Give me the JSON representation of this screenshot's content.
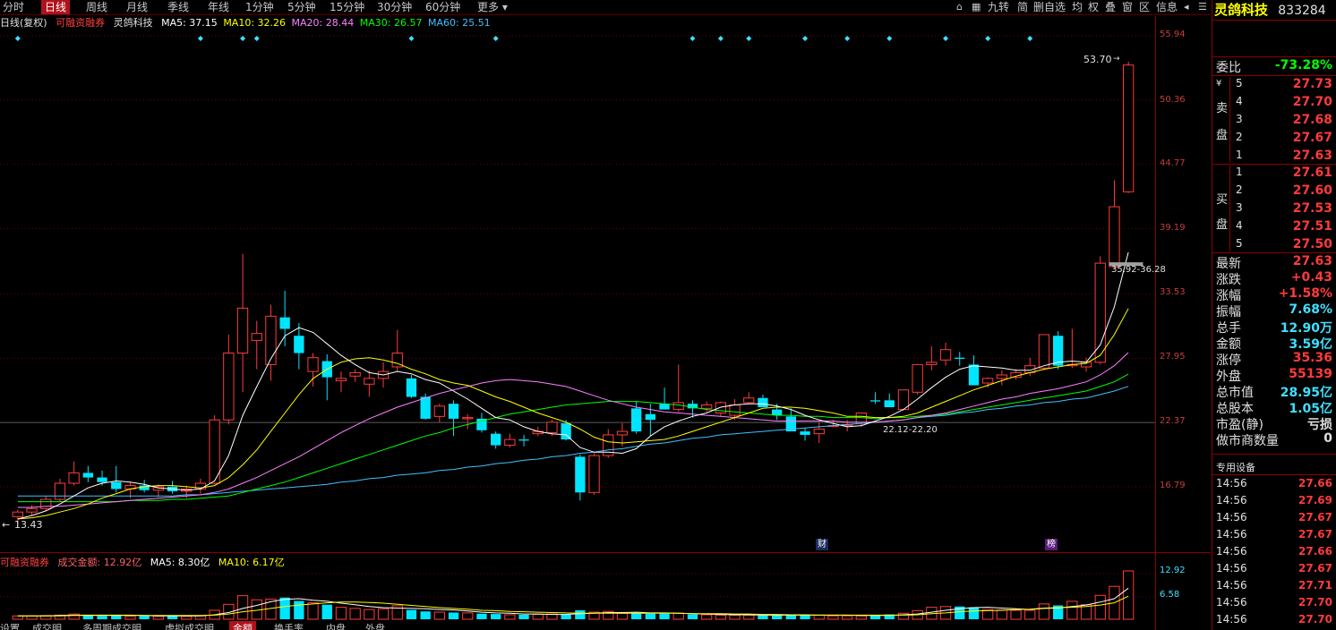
{
  "period_tabs": [
    "分时",
    "日线",
    "周线",
    "月线",
    "季线",
    "年线",
    "1分钟",
    "5分钟",
    "15分钟",
    "30分钟",
    "60分钟",
    "更多"
  ],
  "active_period": "日线",
  "toolbar": [
    "九转",
    "简",
    "删自选",
    "均",
    "权",
    "叠",
    "窗",
    "区",
    "信息"
  ],
  "stock": {
    "name": "灵鸽科技",
    "code": "833284"
  },
  "ma_line": {
    "period": "日线(复权)",
    "tag": "可融资融券",
    "name": "灵鸽科技",
    "ma5": "MA5: 37.15",
    "ma10": "MA10: 32.26",
    "ma20": "MA20: 28.44",
    "ma30": "MA30: 26.57",
    "ma60": "MA60: 25.51"
  },
  "price_axis": [
    "55.94",
    "50.36",
    "44.77",
    "39.19",
    "33.53",
    "27.95",
    "22.37",
    "16.79"
  ],
  "annotations": {
    "high": "53.70",
    "low": "13.43",
    "gap1": "35.92-36.28",
    "gap2": "22.12-22.20",
    "marker_cai": "财",
    "marker_bang": "榜"
  },
  "volume_line": {
    "tag": "可融资融券",
    "amount": "成交金额: 12.92亿",
    "ma5": "MA5: 8.30亿",
    "ma10": "MA10: 6.17亿"
  },
  "volume_axis": [
    "12.92",
    "6.58"
  ],
  "bottom_tabs": [
    "设置",
    "成交明",
    "多周期成交明",
    "虚拟成交明",
    "金额",
    "换手率",
    "内盘",
    "外盘"
  ],
  "order_book": {
    "weibi_label": "委比",
    "weibi_value": "-73.28%",
    "sell_label": [
      "卖",
      "盘"
    ],
    "buy_label": [
      "买",
      "盘"
    ],
    "sell": [
      [
        "5",
        "27.73"
      ],
      [
        "4",
        "27.70"
      ],
      [
        "3",
        "27.68"
      ],
      [
        "2",
        "27.67"
      ],
      [
        "1",
        "27.63"
      ]
    ],
    "buy": [
      [
        "1",
        "27.61"
      ],
      [
        "2",
        "27.60"
      ],
      [
        "3",
        "27.53"
      ],
      [
        "4",
        "27.51"
      ],
      [
        "5",
        "27.50"
      ]
    ]
  },
  "quote": [
    {
      "label": "最新",
      "value": "27.63",
      "color": "#ff3b3b"
    },
    {
      "label": "涨跌",
      "value": "+0.43",
      "color": "#ff3b3b"
    },
    {
      "label": "涨幅",
      "value": "+1.58%",
      "color": "#ff3b3b"
    },
    {
      "label": "振幅",
      "value": "7.68%",
      "color": "#40e0ff"
    },
    {
      "label": "总手",
      "value": "12.90万",
      "color": "#40e0ff"
    },
    {
      "label": "金额",
      "value": "3.59亿",
      "color": "#40e0ff"
    },
    {
      "label": "涨停",
      "value": "35.36",
      "color": "#ff3b3b"
    },
    {
      "label": "外盘",
      "value": "55139",
      "color": "#ff3b3b"
    },
    {
      "label": "总市值",
      "value": "28.95亿",
      "color": "#40e0ff"
    },
    {
      "label": "总股本",
      "value": "1.05亿",
      "color": "#40e0ff"
    },
    {
      "label": "市盈(静)",
      "value": "亏损",
      "color": "#e0e0e0"
    },
    {
      "label": "做市商数量",
      "value": "0",
      "color": "#e0e0e0"
    }
  ],
  "device_label": "专用设备",
  "ticks": [
    [
      "14:56",
      "27.66"
    ],
    [
      "14:56",
      "27.69"
    ],
    [
      "14:56",
      "27.67"
    ],
    [
      "14:56",
      "27.67"
    ],
    [
      "14:56",
      "27.66"
    ],
    [
      "14:56",
      "27.67"
    ],
    [
      "14:56",
      "27.71"
    ],
    [
      "14:56",
      "27.70"
    ],
    [
      "14:56",
      "27.70"
    ]
  ],
  "colors": {
    "up": "#ff3b3b",
    "down": "#00e5ff",
    "ma5": "#ffffff",
    "ma10": "#ffff00",
    "ma20": "#ff80ff",
    "ma30": "#00ff00",
    "ma60": "#40c0ff"
  },
  "kline": [
    [
      14.2,
      14.8,
      13.4,
      14.6
    ],
    [
      14.6,
      15.2,
      14.3,
      14.9
    ],
    [
      14.9,
      16.0,
      14.7,
      15.7
    ],
    [
      15.7,
      17.5,
      15.5,
      17.1
    ],
    [
      17.1,
      19.0,
      16.9,
      18.0
    ],
    [
      18.0,
      18.6,
      17.2,
      17.6
    ],
    [
      17.6,
      18.2,
      16.9,
      17.2
    ],
    [
      17.2,
      18.6,
      16.3,
      16.6
    ],
    [
      16.6,
      17.2,
      15.8,
      16.9
    ],
    [
      16.9,
      17.4,
      16.3,
      16.5
    ],
    [
      16.5,
      17.0,
      15.9,
      16.8
    ],
    [
      16.8,
      17.3,
      16.2,
      16.4
    ],
    [
      16.4,
      16.9,
      15.8,
      16.6
    ],
    [
      16.6,
      17.5,
      16.2,
      17.1
    ],
    [
      17.1,
      23.0,
      17.0,
      22.6
    ],
    [
      22.6,
      30.0,
      22.2,
      28.4
    ],
    [
      28.4,
      37.0,
      25.0,
      32.3
    ],
    [
      29.5,
      31.2,
      27.0,
      30.1
    ],
    [
      27.4,
      32.6,
      26.0,
      31.6
    ],
    [
      31.5,
      33.8,
      29.0,
      30.5
    ],
    [
      29.9,
      31.0,
      27.0,
      28.4
    ],
    [
      26.8,
      28.4,
      25.5,
      28.0
    ],
    [
      27.7,
      28.3,
      24.3,
      26.3
    ],
    [
      26.0,
      26.8,
      25.0,
      26.2
    ],
    [
      26.4,
      27.0,
      25.9,
      26.7
    ],
    [
      25.7,
      26.9,
      24.6,
      26.2
    ],
    [
      26.2,
      27.6,
      25.4,
      26.8
    ],
    [
      27.2,
      30.4,
      26.8,
      28.4
    ],
    [
      26.2,
      26.5,
      24.5,
      24.6
    ],
    [
      24.6,
      24.9,
      22.6,
      22.7
    ],
    [
      22.9,
      24.0,
      22.4,
      23.8
    ],
    [
      24.0,
      24.3,
      21.2,
      22.7
    ],
    [
      22.7,
      23.1,
      21.8,
      22.8
    ],
    [
      22.7,
      23.2,
      21.5,
      21.7
    ],
    [
      21.4,
      21.6,
      20.1,
      20.4
    ],
    [
      20.4,
      21.4,
      20.2,
      20.9
    ],
    [
      20.9,
      21.3,
      20.3,
      20.8
    ],
    [
      21.4,
      22.0,
      21.2,
      21.6
    ],
    [
      21.5,
      22.6,
      21.2,
      22.4
    ],
    [
      22.3,
      22.6,
      20.8,
      20.9
    ],
    [
      19.4,
      19.6,
      15.6,
      16.3
    ],
    [
      16.3,
      19.7,
      16.1,
      19.5
    ],
    [
      19.5,
      21.8,
      19.3,
      21.3
    ],
    [
      21.3,
      22.3,
      20.3,
      21.6
    ],
    [
      23.6,
      24.2,
      21.4,
      21.6
    ],
    [
      23.1,
      24.0,
      21.2,
      22.6
    ],
    [
      24.0,
      25.4,
      23.8,
      23.5
    ],
    [
      23.5,
      27.4,
      23.3,
      24.1
    ],
    [
      24.0,
      24.3,
      22.8,
      23.6
    ],
    [
      23.6,
      24.2,
      23.3,
      23.9
    ],
    [
      23.2,
      24.2,
      22.9,
      24.1
    ],
    [
      23.0,
      24.4,
      22.6,
      23.9
    ],
    [
      24.1,
      25.0,
      24.0,
      24.5
    ],
    [
      24.5,
      24.8,
      24.0,
      23.7
    ],
    [
      23.5,
      24.0,
      22.6,
      23.0
    ],
    [
      22.9,
      23.6,
      22.5,
      21.6
    ],
    [
      21.6,
      21.9,
      20.8,
      21.3
    ],
    [
      21.4,
      22.4,
      20.6,
      21.8
    ],
    [
      22.1,
      22.6,
      22.0,
      22.1
    ],
    [
      22.1,
      22.6,
      21.6,
      22.2
    ],
    [
      22.3,
      23.0,
      22.0,
      23.2
    ],
    [
      24.3,
      25.0,
      24.0,
      24.2
    ],
    [
      24.3,
      24.9,
      23.8,
      23.7
    ],
    [
      23.5,
      24.2,
      23.4,
      25.2
    ],
    [
      25.0,
      26.6,
      24.8,
      27.4
    ],
    [
      27.4,
      29.0,
      26.9,
      27.6
    ],
    [
      27.8,
      29.3,
      27.3,
      28.7
    ],
    [
      28.0,
      28.5,
      27.3,
      27.9
    ],
    [
      27.4,
      28.2,
      25.8,
      25.6
    ],
    [
      25.8,
      26.3,
      25.4,
      26.2
    ],
    [
      26.2,
      26.9,
      25.6,
      26.5
    ],
    [
      26.3,
      27.0,
      26.1,
      26.7
    ],
    [
      26.7,
      28.0,
      26.4,
      27.3
    ],
    [
      27.1,
      28.0,
      26.9,
      30.0
    ],
    [
      29.9,
      30.3,
      27.0,
      27.3
    ],
    [
      27.3,
      30.5,
      27.1,
      27.4
    ],
    [
      27.2,
      28.0,
      26.8,
      27.6
    ],
    [
      27.6,
      36.8,
      27.4,
      36.2
    ],
    [
      35.9,
      43.4,
      35.7,
      41.1
    ],
    [
      42.4,
      53.7,
      42.3,
      53.4
    ]
  ],
  "ma5": [
    14.0,
    14.3,
    14.7,
    15.3,
    16.0,
    16.7,
    17.1,
    17.3,
    17.2,
    17.0,
    16.7,
    16.6,
    16.5,
    16.6,
    17.3,
    19.5,
    23.0,
    25.5,
    27.9,
    29.9,
    30.6,
    30.2,
    29.2,
    28.2,
    27.4,
    26.7,
    26.5,
    26.8,
    26.6,
    26.1,
    25.8,
    25.1,
    24.4,
    23.6,
    22.8,
    22.6,
    22.0,
    21.6,
    21.4,
    21.3,
    20.2,
    19.8,
    19.8,
    19.7,
    20.1,
    21.2,
    22.0,
    22.5,
    22.9,
    23.2,
    23.7,
    23.9,
    24.0,
    24.0,
    23.8,
    23.5,
    23.0,
    22.6,
    22.3,
    22.0,
    22.1,
    22.5,
    22.9,
    23.5,
    24.4,
    25.4,
    26.3,
    27.0,
    27.3,
    27.2,
    27.1,
    26.9,
    26.9,
    27.3,
    27.6,
    27.7,
    27.6,
    29.1,
    32.4,
    37.15
  ],
  "ma10": [
    14.0,
    14.1,
    14.3,
    14.6,
    14.9,
    15.3,
    15.8,
    16.2,
    16.6,
    16.8,
    16.9,
    16.9,
    16.8,
    16.7,
    16.9,
    17.6,
    18.7,
    20.0,
    21.6,
    23.2,
    24.8,
    26.2,
    27.0,
    27.6,
    27.9,
    28.0,
    27.8,
    27.5,
    27.0,
    26.6,
    26.1,
    25.8,
    25.6,
    25.1,
    24.6,
    24.2,
    23.7,
    23.2,
    22.8,
    22.4,
    21.8,
    21.1,
    20.7,
    20.6,
    20.7,
    20.8,
    20.9,
    21.2,
    21.6,
    22.0,
    22.4,
    22.8,
    23.2,
    23.6,
    23.7,
    23.7,
    23.6,
    23.4,
    23.2,
    22.9,
    22.9,
    22.8,
    22.8,
    22.9,
    23.2,
    23.7,
    24.2,
    24.7,
    25.2,
    25.6,
    26.0,
    26.4,
    26.7,
    27.0,
    27.2,
    27.4,
    27.5,
    28.2,
    30.0,
    32.26
  ],
  "ma20": [
    15.0,
    15.0,
    15.1,
    15.1,
    15.2,
    15.3,
    15.4,
    15.5,
    15.6,
    15.7,
    15.8,
    15.9,
    16.0,
    16.1,
    16.3,
    16.6,
    17.1,
    17.6,
    18.2,
    18.8,
    19.4,
    20.1,
    20.8,
    21.5,
    22.1,
    22.7,
    23.2,
    23.7,
    24.1,
    24.5,
    24.9,
    25.2,
    25.5,
    25.8,
    26.0,
    26.1,
    26.0,
    25.9,
    25.7,
    25.5,
    25.1,
    24.7,
    24.3,
    24.0,
    23.7,
    23.5,
    23.3,
    23.2,
    23.1,
    23.0,
    22.9,
    22.8,
    22.7,
    22.6,
    22.5,
    22.5,
    22.5,
    22.5,
    22.5,
    22.4,
    22.4,
    22.4,
    22.5,
    22.6,
    22.8,
    23.0,
    23.2,
    23.5,
    23.8,
    24.1,
    24.4,
    24.6,
    24.9,
    25.1,
    25.3,
    25.6,
    25.9,
    26.5,
    27.3,
    28.44
  ],
  "ma30": [
    15.5,
    15.5,
    15.5,
    15.5,
    15.5,
    15.5,
    15.5,
    15.5,
    15.6,
    15.6,
    15.6,
    15.7,
    15.7,
    15.8,
    15.9,
    16.0,
    16.3,
    16.6,
    16.9,
    17.2,
    17.6,
    18.0,
    18.4,
    18.8,
    19.2,
    19.6,
    20.0,
    20.4,
    20.8,
    21.2,
    21.5,
    21.9,
    22.2,
    22.5,
    22.8,
    23.1,
    23.3,
    23.5,
    23.7,
    23.9,
    24.0,
    24.1,
    24.2,
    24.2,
    24.2,
    24.1,
    24.0,
    23.9,
    23.7,
    23.5,
    23.4,
    23.3,
    23.2,
    23.1,
    23.0,
    23.0,
    22.9,
    22.9,
    22.8,
    22.8,
    22.8,
    22.7,
    22.8,
    22.8,
    22.9,
    23.0,
    23.1,
    23.3,
    23.5,
    23.7,
    23.9,
    24.1,
    24.3,
    24.5,
    24.7,
    24.9,
    25.1,
    25.5,
    25.9,
    26.57
  ],
  "ma60": [
    16.0,
    16.0,
    16.0,
    16.0,
    16.0,
    16.0,
    16.0,
    16.0,
    16.0,
    16.0,
    16.0,
    16.0,
    16.1,
    16.1,
    16.2,
    16.3,
    16.4,
    16.5,
    16.6,
    16.7,
    16.8,
    16.9,
    17.0,
    17.2,
    17.3,
    17.5,
    17.6,
    17.8,
    17.9,
    18.0,
    18.2,
    18.3,
    18.5,
    18.6,
    18.8,
    18.9,
    19.1,
    19.2,
    19.4,
    19.5,
    19.7,
    19.8,
    20.0,
    20.1,
    20.3,
    20.5,
    20.6,
    20.8,
    21.0,
    21.1,
    21.3,
    21.4,
    21.5,
    21.6,
    21.7,
    21.8,
    21.9,
    22.0,
    22.1,
    22.2,
    22.3,
    22.4,
    22.5,
    22.6,
    22.8,
    22.9,
    23.0,
    23.2,
    23.3,
    23.5,
    23.6,
    23.8,
    23.9,
    24.1,
    24.2,
    24.4,
    24.5,
    24.8,
    25.1,
    25.51
  ],
  "volume": [
    0.9,
    0.9,
    1.0,
    1.1,
    1.4,
    1.0,
    0.9,
    1.2,
    0.8,
    0.9,
    0.8,
    0.9,
    0.8,
    0.9,
    2.4,
    4.0,
    6.3,
    5.2,
    5.4,
    5.8,
    4.9,
    4.4,
    3.9,
    3.2,
    2.9,
    2.6,
    2.8,
    3.6,
    2.5,
    2.1,
    1.9,
    1.8,
    1.7,
    1.5,
    1.4,
    1.2,
    1.2,
    1.3,
    1.4,
    1.2,
    2.4,
    1.9,
    2.1,
    1.6,
    1.6,
    1.5,
    1.5,
    1.6,
    1.3,
    1.2,
    1.1,
    1.1,
    1.1,
    1.0,
    1.0,
    1.3,
    1.2,
    1.1,
    0.9,
    0.9,
    0.9,
    1.1,
    1.3,
    1.6,
    2.3,
    3.2,
    3.4,
    3.4,
    3.2,
    2.6,
    2.5,
    2.4,
    2.4,
    4.1,
    3.7,
    4.8,
    3.9,
    6.4,
    8.8,
    12.92
  ],
  "vol_ma5": [
    0.9,
    0.9,
    0.9,
    1.0,
    1.1,
    1.1,
    1.1,
    1.1,
    1.1,
    1.0,
    0.9,
    0.9,
    0.9,
    0.9,
    1.2,
    1.8,
    2.9,
    3.7,
    4.7,
    5.3,
    5.5,
    5.1,
    4.8,
    4.3,
    3.9,
    3.4,
    3.1,
    3.0,
    2.9,
    2.8,
    2.6,
    2.5,
    2.2,
    1.9,
    1.7,
    1.6,
    1.4,
    1.4,
    1.3,
    1.3,
    1.5,
    1.6,
    1.8,
    1.8,
    1.9,
    1.7,
    1.7,
    1.6,
    1.5,
    1.4,
    1.3,
    1.2,
    1.2,
    1.1,
    1.1,
    1.1,
    1.1,
    1.1,
    1.1,
    1.1,
    1.0,
    1.0,
    1.0,
    1.2,
    1.4,
    1.9,
    2.4,
    2.8,
    3.1,
    3.2,
    3.0,
    2.8,
    2.6,
    2.9,
    3.0,
    3.4,
    3.8,
    4.6,
    5.5,
    8.3
  ],
  "vol_ma10": [
    0.9,
    0.9,
    0.9,
    0.9,
    1.0,
    1.0,
    1.0,
    1.0,
    1.0,
    1.0,
    1.0,
    1.0,
    1.0,
    1.0,
    1.1,
    1.4,
    2.0,
    2.4,
    2.9,
    3.4,
    3.8,
    4.1,
    4.4,
    4.6,
    4.6,
    4.5,
    4.3,
    4.0,
    3.7,
    3.4,
    3.1,
    2.9,
    2.7,
    2.4,
    2.3,
    2.1,
    2.0,
    1.9,
    1.8,
    1.7,
    1.6,
    1.6,
    1.6,
    1.6,
    1.6,
    1.6,
    1.6,
    1.6,
    1.5,
    1.5,
    1.5,
    1.4,
    1.4,
    1.3,
    1.3,
    1.2,
    1.2,
    1.1,
    1.1,
    1.1,
    1.1,
    1.1,
    1.1,
    1.1,
    1.2,
    1.5,
    1.7,
    2.0,
    2.2,
    2.3,
    2.4,
    2.6,
    2.7,
    3.0,
    3.1,
    3.2,
    3.4,
    3.8,
    4.4,
    6.17
  ],
  "diamond_markers": [
    0,
    13,
    16,
    17,
    28,
    34,
    48,
    50,
    52,
    56,
    59,
    62,
    66,
    69,
    72
  ]
}
